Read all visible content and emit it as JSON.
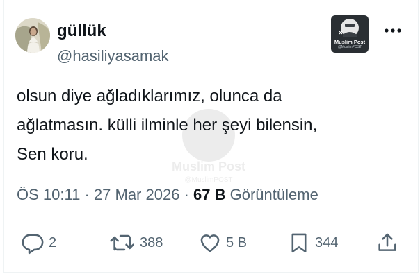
{
  "author": {
    "display_name": "güllük",
    "handle": "@hasiliyasamak"
  },
  "brand": {
    "logo_name": "Muslim Post",
    "logo_handle": "@MuslimPOST",
    "watermark_name": "Muslim Post",
    "watermark_handle": "@MuslimPOST"
  },
  "tweet": {
    "text": "olsun diye ağladıklarımız, olunca da\nağlatmasın. külli ilminle her şeyi bilensin,\nSen koru."
  },
  "meta": {
    "time": "ÖS 10:11",
    "separator": "·",
    "date": "27 Mar 2026",
    "views_count": "67 B",
    "views_label": "Görüntüleme"
  },
  "actions": {
    "replies": "2",
    "reposts": "388",
    "likes": "5 B",
    "bookmarks": "344"
  },
  "colors": {
    "text_primary": "#0f1419",
    "text_secondary": "#536471",
    "divider": "#eff3f4",
    "background": "#ffffff"
  },
  "icons": {
    "more": "more-horizontal-icon",
    "reply": "reply-bubble-icon",
    "repost": "repost-arrows-icon",
    "like": "heart-icon",
    "bookmark": "bookmark-icon",
    "share": "share-upload-icon"
  }
}
